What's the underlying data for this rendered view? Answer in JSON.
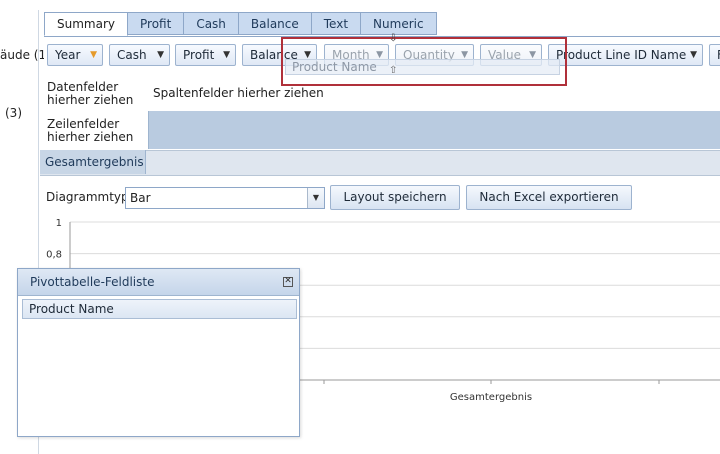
{
  "left_clipped": {
    "text1": "äude (1",
    "text2": "(3)"
  },
  "tabs": [
    {
      "label": "Summary",
      "active": true
    },
    {
      "label": "Profit",
      "active": false
    },
    {
      "label": "Cash",
      "active": false
    },
    {
      "label": "Balance",
      "active": false
    },
    {
      "label": "Text",
      "active": false
    },
    {
      "label": "Numeric",
      "active": false
    }
  ],
  "filter_fields": [
    {
      "label": "Year",
      "icon": "filter-active-icon"
    },
    {
      "label": "Cash",
      "icon": "filter-icon"
    },
    {
      "label": "Profit",
      "icon": "filter-icon"
    },
    {
      "label": "Balance",
      "icon": "filter-icon"
    },
    {
      "label": "Month",
      "icon": "filter-icon"
    },
    {
      "label": "Quantity",
      "icon": "filter-icon"
    },
    {
      "label": "Value",
      "icon": "filter-icon"
    },
    {
      "label": "Product Line ID Name",
      "icon": "filter-icon"
    },
    {
      "label": "F",
      "icon": "filter-icon"
    }
  ],
  "pivot": {
    "data_zone_label": "Datenfelder\nhierher ziehen",
    "column_zone_label": "Spaltenfelder hierher ziehen",
    "row_zone_label": "Zeilenfelder\nhierher ziehen",
    "grand_total_label": "Gesamtergebnis"
  },
  "chart_controls": {
    "type_label": "Diagrammtyp",
    "type_value": "Bar",
    "save_layout_label": "Layout speichern",
    "export_excel_label": "Nach Excel exportieren"
  },
  "drag": {
    "ghost_label": "Product Name",
    "drop_indicator_color": "#b0303a"
  },
  "field_list": {
    "title": "Pivottabelle-Feldliste",
    "items": [
      "Product Name"
    ]
  },
  "chart_data": {
    "type": "bar",
    "categories": [
      "Gesamtergebnis"
    ],
    "series": [],
    "ylim": [
      0,
      1
    ],
    "y_ticks": [
      "1",
      "0,8"
    ],
    "grid": true
  },
  "colors": {
    "tab_bg": "#c9daf0",
    "header_band": "#b9cbe0",
    "total_row": "#dfe6ef",
    "border": "#8ea7c8"
  }
}
